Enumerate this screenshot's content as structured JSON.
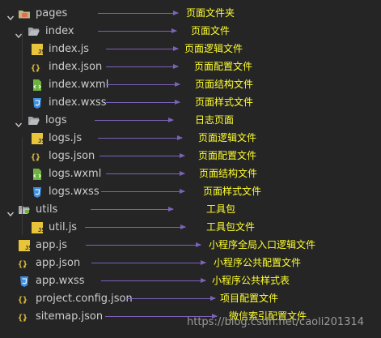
{
  "tree": [
    {
      "id": "pages",
      "label": "pages",
      "icon": "folder-pages-icon",
      "chev": "chevron-down-icon",
      "note": "页面文件夹"
    },
    {
      "id": "index",
      "label": "index",
      "icon": "folder-open-icon",
      "chev": "chevron-down-icon",
      "note": "页面文件"
    },
    {
      "id": "index-js",
      "label": "index.js",
      "icon": "js-file-icon",
      "note": "页面逻辑文件"
    },
    {
      "id": "index-json",
      "label": "index.json",
      "icon": "json-file-icon",
      "note": "页面配置文件"
    },
    {
      "id": "index-wxml",
      "label": "index.wxml",
      "icon": "wxml-file-icon",
      "note": "页面结构文件"
    },
    {
      "id": "index-wxss",
      "label": "index.wxss",
      "icon": "wxss-file-icon",
      "note": "页面样式文件"
    },
    {
      "id": "logs",
      "label": "logs",
      "icon": "folder-open-icon",
      "chev": "chevron-down-icon",
      "note": "日志页面"
    },
    {
      "id": "logs-js",
      "label": "logs.js",
      "icon": "js-file-icon",
      "note": "页面逻辑文件"
    },
    {
      "id": "logs-json",
      "label": "logs.json",
      "icon": "json-file-icon",
      "note": "页面配置文件"
    },
    {
      "id": "logs-wxml",
      "label": "logs.wxml",
      "icon": "wxml-file-icon",
      "note": "页面结构文件"
    },
    {
      "id": "logs-wxss",
      "label": "logs.wxss",
      "icon": "wxss-file-icon",
      "note": "页面样式文件"
    },
    {
      "id": "utils",
      "label": "utils",
      "icon": "folder-utils-icon",
      "chev": "chevron-down-icon",
      "note": "工具包"
    },
    {
      "id": "util-js",
      "label": "util.js",
      "icon": "js-file-icon",
      "note": "工具包文件"
    },
    {
      "id": "app-js",
      "label": "app.js",
      "icon": "js-file-icon",
      "note": "小程序全局入口逻辑文件"
    },
    {
      "id": "app-json",
      "label": "app.json",
      "icon": "json-file-icon",
      "note": "小程序公共配置文件"
    },
    {
      "id": "app-wxss",
      "label": "app.wxss",
      "icon": "wxss-file-icon",
      "note": "小程序公共样式表"
    },
    {
      "id": "project-config-json",
      "label": "project.config.json",
      "icon": "json-file-icon",
      "note": "项目配置文件"
    },
    {
      "id": "sitemap-json",
      "label": "sitemap.json",
      "icon": "json-file-icon",
      "note": "微信索引配置文件"
    }
  ],
  "watermark": "https://blog.csdn.net/caoli201314",
  "colors": {
    "background": "#252526",
    "text": "#cccccc",
    "note": "#ffff2e",
    "arrow": "#7d62b8",
    "js": "#e8c43a",
    "json": "#e8c43a",
    "wxml": "#6db33f",
    "wxss": "#3d8fe0",
    "folder": "#c5b47a",
    "pagesFolder": "#e06c5a"
  }
}
